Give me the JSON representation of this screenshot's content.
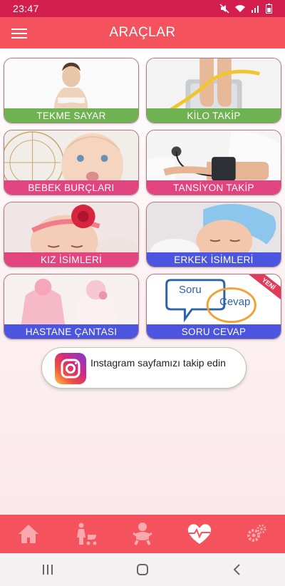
{
  "status": {
    "time": "23:47"
  },
  "header": {
    "title": "ARAÇLAR"
  },
  "cards": [
    {
      "label": "TEKME SAYAR"
    },
    {
      "label": "KİLO TAKİP"
    },
    {
      "label": "BEBEK BURÇLARI"
    },
    {
      "label": "TANSİYON TAKİP"
    },
    {
      "label": "KIZ İSİMLERİ"
    },
    {
      "label": "ERKEK İSİMLERİ"
    },
    {
      "label": "HASTANE ÇANTASI"
    },
    {
      "label": "SORU CEVAP",
      "badge": "YENİ",
      "bubble_left": "Soru",
      "bubble_right": "Cevap"
    }
  ],
  "instagram": {
    "text": "Instagram sayfamızı takip edin"
  },
  "bottom_nav": [
    "home-icon",
    "mother-stroller-icon",
    "baby-icon",
    "heart-pulse-icon",
    "gears-icon"
  ],
  "colors": {
    "primary": "#f4525c",
    "status": "#d41e4e",
    "green": "#6fb251",
    "pink": "#e2447f",
    "blue": "#4b55e0"
  }
}
